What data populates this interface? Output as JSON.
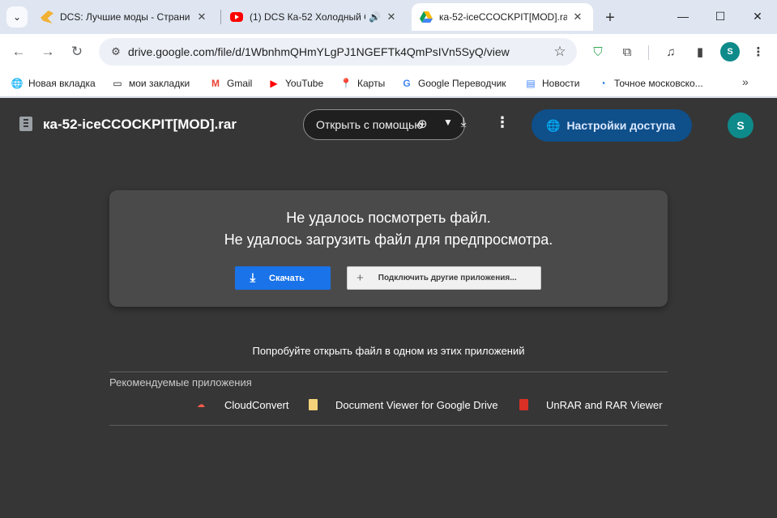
{
  "tabs": [
    {
      "title": "DCS: Лучшие моды - Страни"
    },
    {
      "title": "(1) DCS Ка-52 Холодный С"
    },
    {
      "title": "ка-52-iceCCOCKPIT[MOD].rar"
    }
  ],
  "toolbar": {
    "url": "drive.google.com/file/d/1WbnhmQHmYLgPJ1NGEFTk4QmPsIVn5SyQ/view",
    "profile_initial": "S"
  },
  "bookmarks": [
    {
      "label": "Новая вкладка"
    },
    {
      "label": "мои закладки"
    },
    {
      "label": "Gmail"
    },
    {
      "label": "YouTube"
    },
    {
      "label": "Карты"
    },
    {
      "label": "Google Переводчик"
    },
    {
      "label": "Новости"
    },
    {
      "label": "Точное московско..."
    }
  ],
  "viewer": {
    "file_name": "ка-52-iceCCOCKPIT[MOD].rar",
    "open_with": "Открыть с помощью",
    "share_label": "Настройки доступа",
    "avatar_initial": "S",
    "error_line1": "Не удалось посмотреть файл.",
    "error_line2": "Не удалось загрузить файл для предпросмотра.",
    "download_label": "Скачать",
    "connect_label": "Подключить другие приложения...",
    "try_text": "Попробуйте открыть файл в одном из этих приложений",
    "recommended_label": "Рекомендуемые приложения",
    "apps": [
      {
        "name": "CloudConvert"
      },
      {
        "name": "Document Viewer for Google Drive"
      },
      {
        "name": "UnRAR and RAR Viewer"
      }
    ]
  },
  "colors": {
    "viewer_bg": "#363636",
    "card_bg": "#4b4a4b",
    "primary_button": "#1a73e8",
    "share_button": "#0f4f8a",
    "avatar": "#0e8a8a"
  }
}
